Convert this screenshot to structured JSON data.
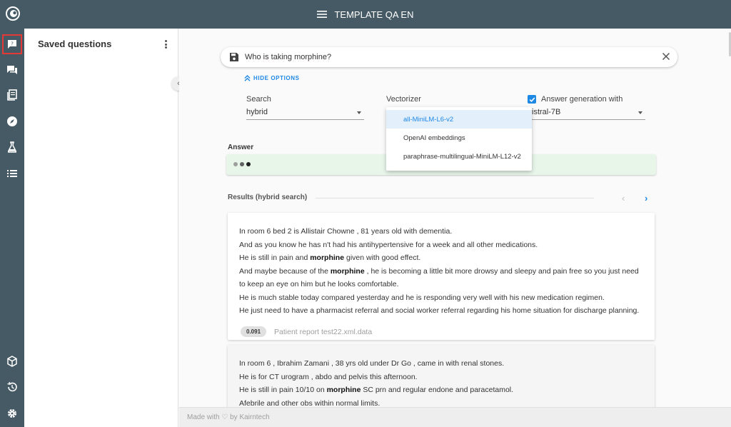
{
  "app": {
    "title": "TEMPLATE QA EN",
    "colors": {
      "topbar": "#455a64",
      "accent": "#1e88e5",
      "answer_bg": "#e8f5e9",
      "active_outline": "#e53935"
    }
  },
  "rail": {
    "items": [
      {
        "icon": "question-icon",
        "active": true
      },
      {
        "icon": "chat-icon"
      },
      {
        "icon": "document-icon"
      },
      {
        "icon": "compass-icon"
      },
      {
        "icon": "flask-icon"
      },
      {
        "icon": "list-icon"
      }
    ],
    "bottom_items": [
      {
        "icon": "cube-icon"
      },
      {
        "icon": "history-icon"
      },
      {
        "icon": "settings-icon"
      }
    ]
  },
  "saved_panel": {
    "title": "Saved questions"
  },
  "search": {
    "query": "Who is taking morphine?"
  },
  "options": {
    "hide_label": "HIDE OPTIONS",
    "search_label": "Search",
    "search_value": "hybrid",
    "vectorizer_label": "Vectorizer",
    "answer_gen_label": "Answer generation with",
    "answer_gen_checked": true,
    "model_value": "istral-7B",
    "vectorizer_options": [
      "all-MiniLM-L6-v2",
      "OpenAI embeddings",
      "paraphrase-multilingual-MiniLM-L12-v2"
    ],
    "vectorizer_selected": "all-MiniLM-L6-v2"
  },
  "answer": {
    "label": "Answer",
    "loading": true
  },
  "results": {
    "label": "Results (hybrid search)",
    "cards": [
      {
        "lines": [
          [
            {
              "t": "In room 6 bed 2 is Allistair Chowne , 81 years old with dementia."
            }
          ],
          [
            {
              "t": "And as you know he has n't had his antihypertensive for a week and all other medications."
            }
          ],
          [
            {
              "t": "He is still in pain and "
            },
            {
              "t": "morphine",
              "b": true
            },
            {
              "t": " given with good effect."
            }
          ],
          [
            {
              "t": "And maybe because of the "
            },
            {
              "t": "morphine",
              "b": true
            },
            {
              "t": " , he is becoming a little bit more drowsy and sleepy and pain free so you just need to keep an eye on him but he looks comfortable."
            }
          ],
          [
            {
              "t": "He is much stable today compared yesterday and he is responding very well with his new medication regimen."
            }
          ],
          [
            {
              "t": "He just need to have a pharmacist referral and social worker referral regarding his home situation for discharge planning."
            }
          ]
        ],
        "score": "0.091",
        "source": "Patient report test22.xml.data"
      },
      {
        "lines": [
          [
            {
              "t": "In room 6 , Ibrahim Zamani , 38 yrs old under Dr Go , came in with renal stones."
            }
          ],
          [
            {
              "t": "He is for CT urogram , abdo and pelvis this afternoon."
            }
          ],
          [
            {
              "t": "He is still in pain 10/10 on "
            },
            {
              "t": "morphine",
              "b": true
            },
            {
              "t": " SC prn and regular endone and paracetamol."
            }
          ],
          [
            {
              "t": "Afebrile and other obs within normal limits."
            }
          ]
        ]
      }
    ]
  },
  "footer": {
    "text": "Made with ♡ by Kairntech"
  }
}
